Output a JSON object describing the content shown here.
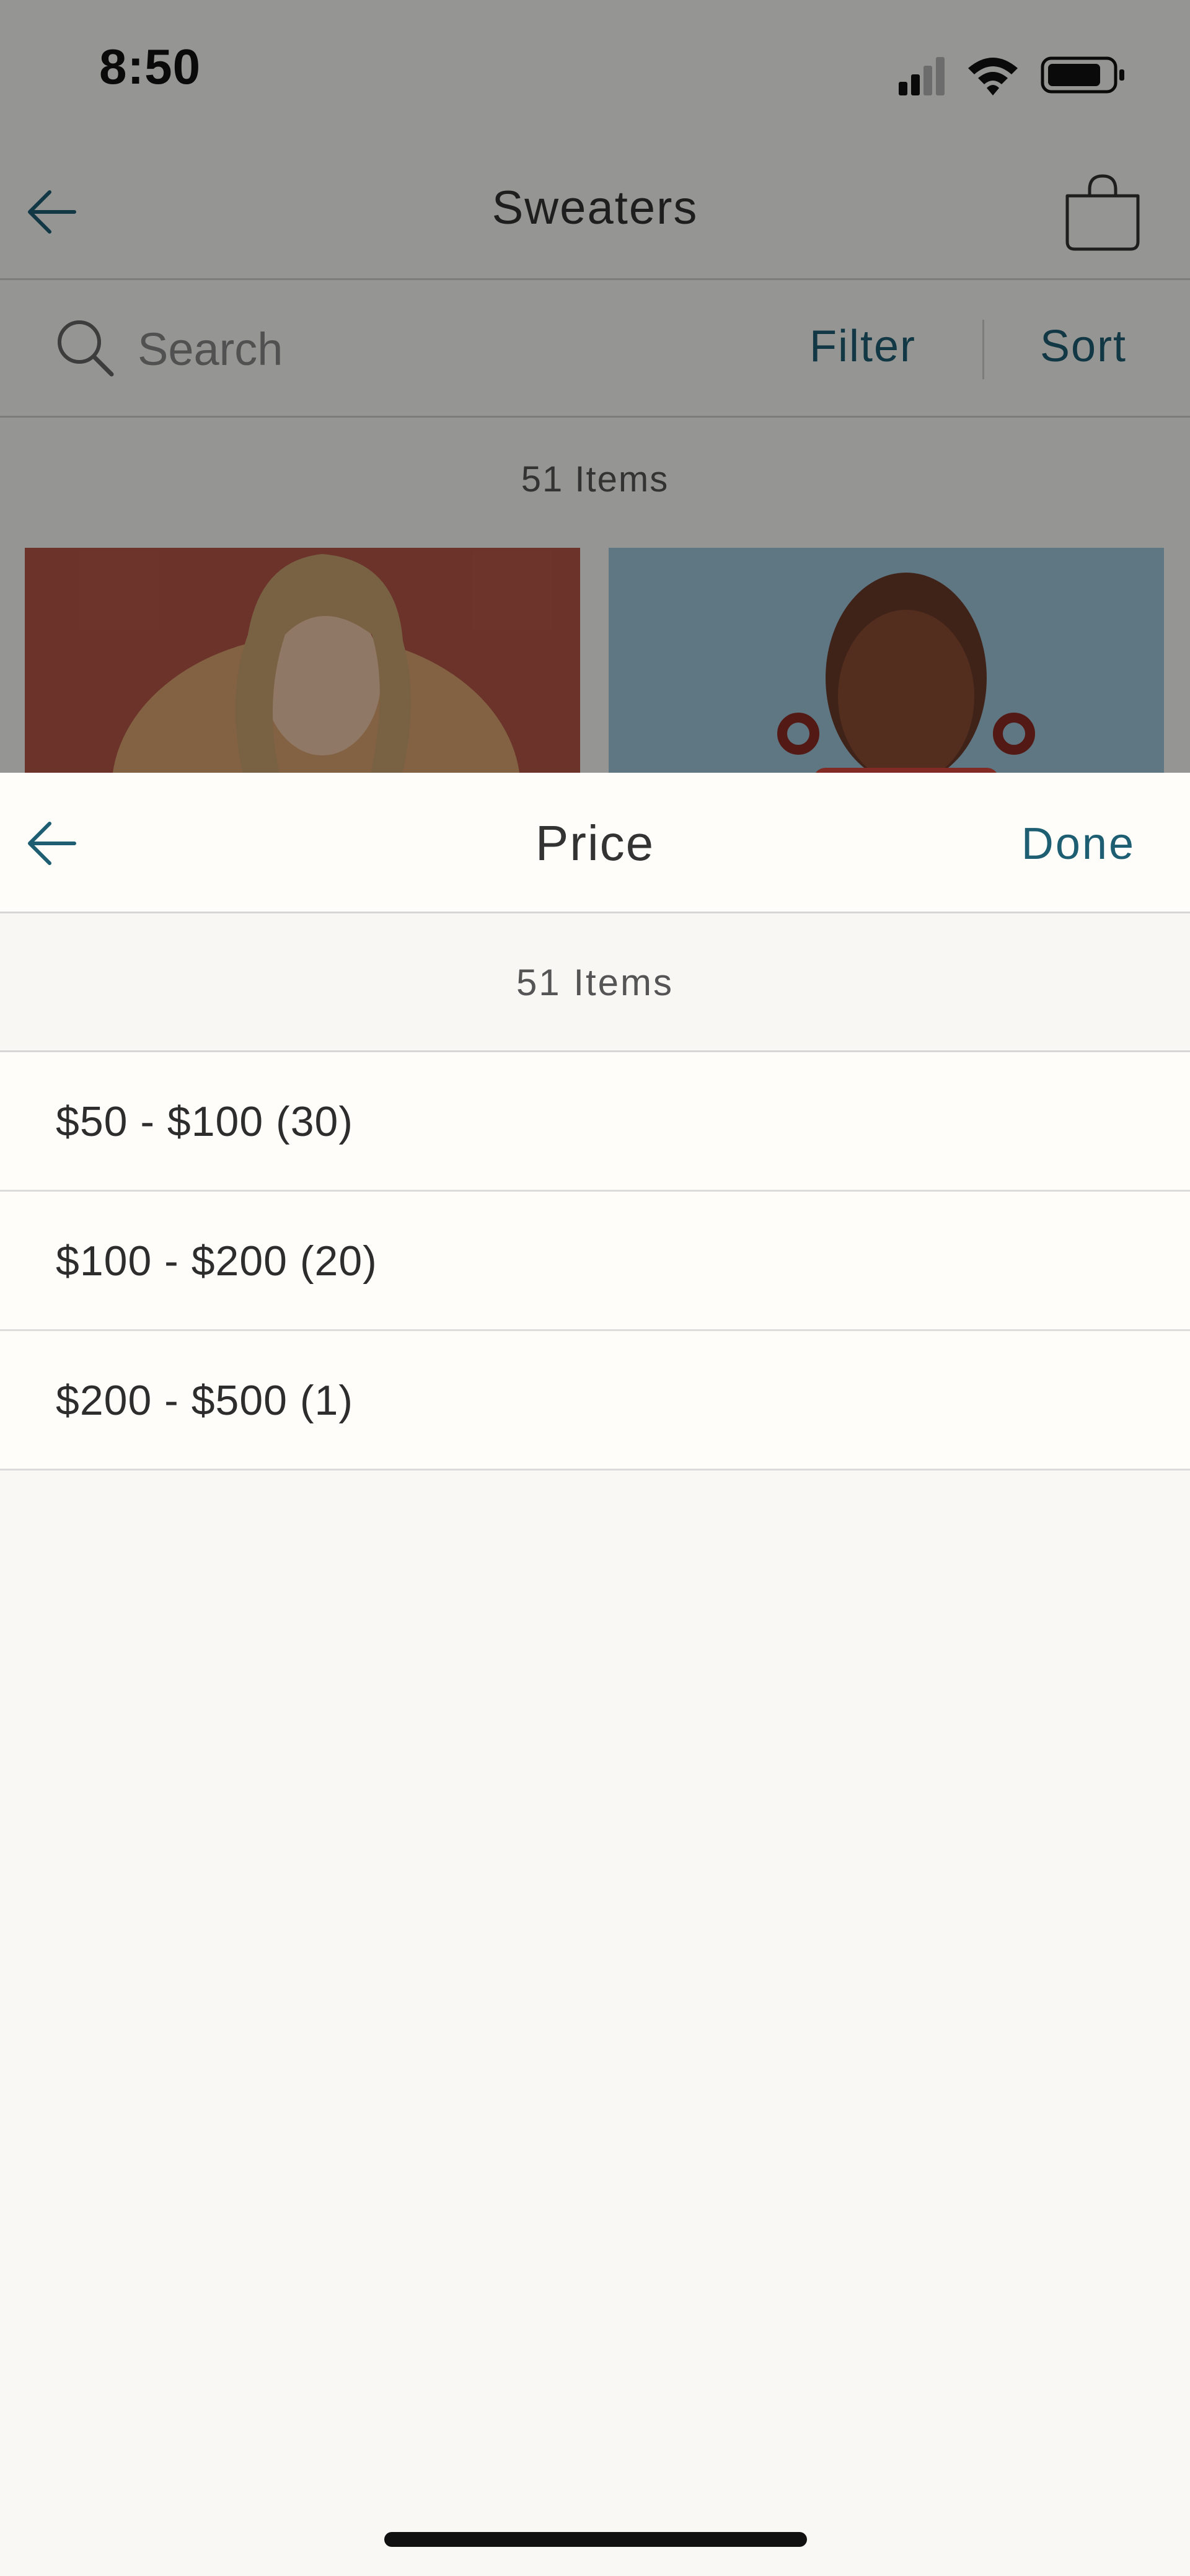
{
  "status_bar": {
    "time": "8:50",
    "icons": [
      "cellular-signal-icon",
      "wifi-icon",
      "battery-icon"
    ]
  },
  "nav": {
    "title": "Sweaters",
    "back_icon": "back-arrow-icon",
    "bag_icon": "shopping-bag-icon"
  },
  "search": {
    "placeholder": "Search",
    "filter_label": "Filter",
    "sort_label": "Sort"
  },
  "background_list": {
    "count_label": "51 Items"
  },
  "price_sheet": {
    "title": "Price",
    "done_label": "Done",
    "count_label": "51 Items",
    "options": [
      {
        "label": "$50 - $100 (30)"
      },
      {
        "label": "$100 - $200 (20)"
      },
      {
        "label": "$200 - $500 (1)"
      }
    ]
  },
  "colors": {
    "accent": "#1d5e72",
    "background": "#f9f8f5",
    "sheet_surface": "#fefdfa",
    "divider": "#d6d6d6",
    "text": "#333333"
  }
}
